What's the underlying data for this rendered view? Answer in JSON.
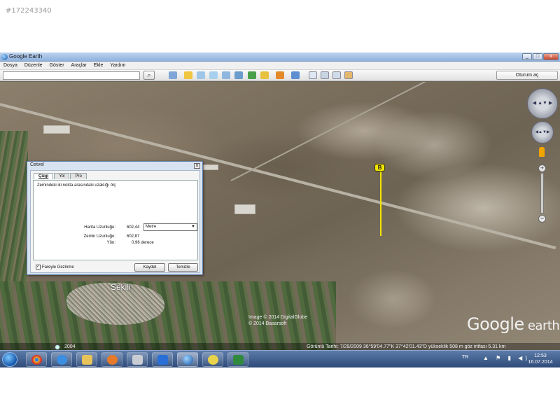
{
  "listing_id": "#172243340",
  "window": {
    "title": "Google Earth",
    "buttons": [
      "_",
      "□",
      "x"
    ]
  },
  "menu": [
    "Dosya",
    "Düzenle",
    "Göster",
    "Araçlar",
    "Ekle",
    "Yardım"
  ],
  "toolbar": {
    "search_value": "",
    "search_icon": "search-icon",
    "signin_label": "Oturum aç"
  },
  "map": {
    "marker_label": "B",
    "town_label": "Sekili",
    "credits_line1": "Image © 2014 DigitalGlobe",
    "credits_line2": "© 2014 Basarsoft",
    "logo_main": "Google",
    "logo_sub": " earth"
  },
  "ruler": {
    "title": "Cetvel",
    "close": "x",
    "tabs": [
      "Çizgi",
      "Yol",
      "Pro"
    ],
    "instruction": "Zemindeki iki nokta arasındaki uzaklığı ölç",
    "map_length_label": "Harita Uzunluğu:",
    "map_length_value": "602,44",
    "unit": "Metre",
    "ground_length_label": "Zemin Uzunluğu:",
    "ground_length_value": "602,87",
    "heading_label": "Yön:",
    "heading_value": "0,96 derece",
    "mouse_nav_label": "Fareyle Gezinme",
    "mouse_nav_checked": true,
    "save_label": "Kaydet",
    "clear_label": "Temizle"
  },
  "status": {
    "year": "2004",
    "info": "Görüntü Tarihi: 7/29/2009    36°59'04.77\"K    37°42'01.43\"D  yükseklik   508 m     göz irtifası    5.31 km"
  },
  "taskbar": {
    "language": "TR",
    "tray": "▲ ⚑ ▮ ◀)",
    "time": "12:53",
    "date": "16.07.2014"
  }
}
